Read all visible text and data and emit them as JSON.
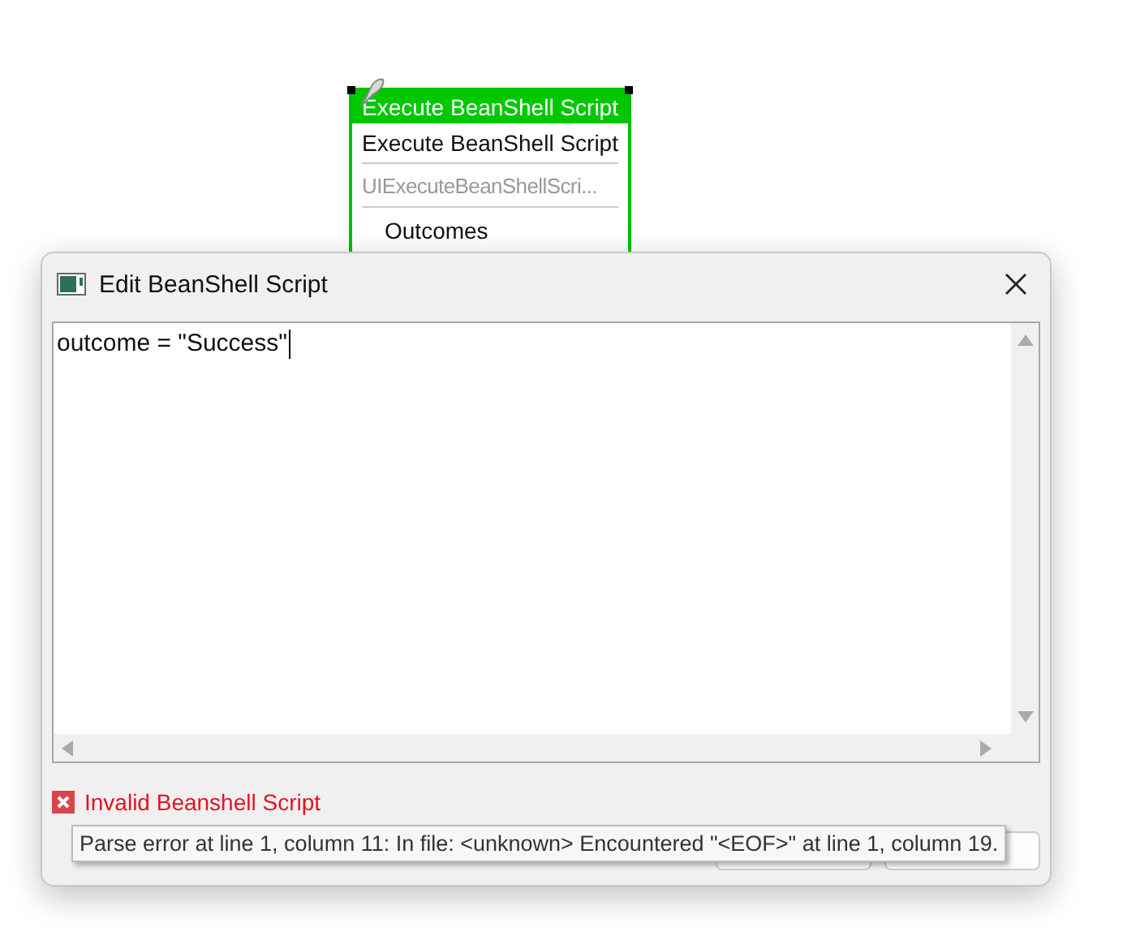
{
  "node": {
    "title": "Execute BeanShell Script",
    "name": "Execute BeanShell Script",
    "class_name": "UIExecuteBeanShellScri...",
    "section": "Outcomes",
    "selected": true
  },
  "dialog": {
    "title": "Edit BeanShell Script",
    "script": "outcome = \"Success\"",
    "error": "Invalid Beanshell Script",
    "tooltip": "Parse error at line 1, column 11: In file: <unknown> Encountered \"<EOF>\" at line 1, column 19."
  }
}
